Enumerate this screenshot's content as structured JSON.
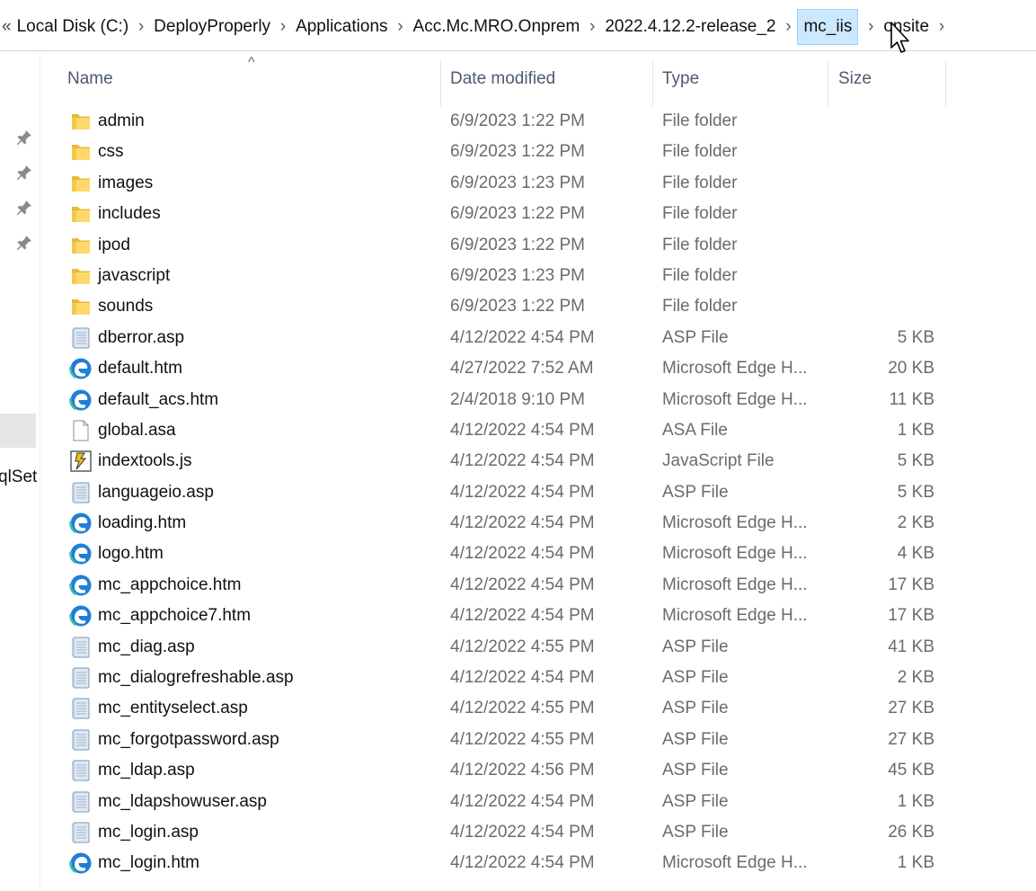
{
  "breadcrumb": {
    "overflow_icon": "«",
    "items": [
      "Local Disk (C:)",
      "DeployProperly",
      "Applications",
      "Acc.Mc.MRO.Onprem",
      "2022.4.12.2-release_2",
      "mc_iis",
      "onsite"
    ],
    "active_index": 5
  },
  "navpane": {
    "pinned_icons": [
      "pin-icon",
      "pin-icon",
      "pin-icon",
      "pin-icon"
    ],
    "partial_label": "qlSet"
  },
  "columns": {
    "name": "Name",
    "date": "Date modified",
    "type": "Type",
    "size": "Size"
  },
  "files": [
    {
      "icon": "folder-icon",
      "name": "admin",
      "date": "6/9/2023 1:22 PM",
      "type": "File folder",
      "size": ""
    },
    {
      "icon": "folder-icon",
      "name": "css",
      "date": "6/9/2023 1:22 PM",
      "type": "File folder",
      "size": ""
    },
    {
      "icon": "folder-icon",
      "name": "images",
      "date": "6/9/2023 1:23 PM",
      "type": "File folder",
      "size": ""
    },
    {
      "icon": "folder-icon",
      "name": "includes",
      "date": "6/9/2023 1:22 PM",
      "type": "File folder",
      "size": ""
    },
    {
      "icon": "folder-icon",
      "name": "ipod",
      "date": "6/9/2023 1:22 PM",
      "type": "File folder",
      "size": ""
    },
    {
      "icon": "folder-icon",
      "name": "javascript",
      "date": "6/9/2023 1:23 PM",
      "type": "File folder",
      "size": ""
    },
    {
      "icon": "folder-icon",
      "name": "sounds",
      "date": "6/9/2023 1:22 PM",
      "type": "File folder",
      "size": ""
    },
    {
      "icon": "asp-file-icon",
      "name": "dberror.asp",
      "date": "4/12/2022 4:54 PM",
      "type": "ASP File",
      "size": "5 KB"
    },
    {
      "icon": "edge-icon",
      "name": "default.htm",
      "date": "4/27/2022 7:52 AM",
      "type": "Microsoft Edge H...",
      "size": "20 KB"
    },
    {
      "icon": "edge-icon",
      "name": "default_acs.htm",
      "date": "2/4/2018 9:10 PM",
      "type": "Microsoft Edge H...",
      "size": "11 KB"
    },
    {
      "icon": "blank-file-icon",
      "name": "global.asa",
      "date": "4/12/2022 4:54 PM",
      "type": "ASA File",
      "size": "1 KB"
    },
    {
      "icon": "js-file-icon",
      "name": "indextools.js",
      "date": "4/12/2022 4:54 PM",
      "type": "JavaScript File",
      "size": "5 KB"
    },
    {
      "icon": "asp-file-icon",
      "name": "languageio.asp",
      "date": "4/12/2022 4:54 PM",
      "type": "ASP File",
      "size": "5 KB"
    },
    {
      "icon": "edge-icon",
      "name": "loading.htm",
      "date": "4/12/2022 4:54 PM",
      "type": "Microsoft Edge H...",
      "size": "2 KB"
    },
    {
      "icon": "edge-icon",
      "name": "logo.htm",
      "date": "4/12/2022 4:54 PM",
      "type": "Microsoft Edge H...",
      "size": "4 KB"
    },
    {
      "icon": "edge-icon",
      "name": "mc_appchoice.htm",
      "date": "4/12/2022 4:54 PM",
      "type": "Microsoft Edge H...",
      "size": "17 KB"
    },
    {
      "icon": "edge-icon",
      "name": "mc_appchoice7.htm",
      "date": "4/12/2022 4:54 PM",
      "type": "Microsoft Edge H...",
      "size": "17 KB"
    },
    {
      "icon": "asp-file-icon",
      "name": "mc_diag.asp",
      "date": "4/12/2022 4:55 PM",
      "type": "ASP File",
      "size": "41 KB"
    },
    {
      "icon": "asp-file-icon",
      "name": "mc_dialogrefreshable.asp",
      "date": "4/12/2022 4:54 PM",
      "type": "ASP File",
      "size": "2 KB"
    },
    {
      "icon": "asp-file-icon",
      "name": "mc_entityselect.asp",
      "date": "4/12/2022 4:55 PM",
      "type": "ASP File",
      "size": "27 KB"
    },
    {
      "icon": "asp-file-icon",
      "name": "mc_forgotpassword.asp",
      "date": "4/12/2022 4:55 PM",
      "type": "ASP File",
      "size": "27 KB"
    },
    {
      "icon": "asp-file-icon",
      "name": "mc_ldap.asp",
      "date": "4/12/2022 4:56 PM",
      "type": "ASP File",
      "size": "45 KB"
    },
    {
      "icon": "asp-file-icon",
      "name": "mc_ldapshowuser.asp",
      "date": "4/12/2022 4:54 PM",
      "type": "ASP File",
      "size": "1 KB"
    },
    {
      "icon": "asp-file-icon",
      "name": "mc_login.asp",
      "date": "4/12/2022 4:54 PM",
      "type": "ASP File",
      "size": "26 KB"
    },
    {
      "icon": "edge-icon",
      "name": "mc_login.htm",
      "date": "4/12/2022 4:54 PM",
      "type": "Microsoft Edge H...",
      "size": "1 KB"
    }
  ]
}
